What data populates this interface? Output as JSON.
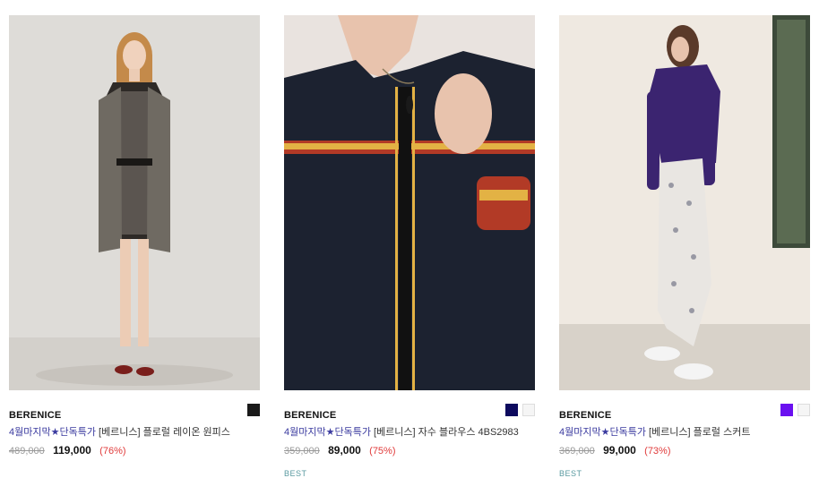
{
  "products": [
    {
      "brand": "BERENICE",
      "promo": "4월마지막★단독특가",
      "title": " [베르니스] 플로럴 레이온 원피스",
      "original_price": "489,000",
      "sale_price": "119,000",
      "discount": "(76%)",
      "swatches": [
        "#1a1a1a"
      ],
      "image": "model-floral-dress-fringe-vest"
    },
    {
      "brand": "BERENICE",
      "promo": "4월마지막★단독특가",
      "title": " [베르니스] 자수 블라우스 4BS2983",
      "original_price": "359,000",
      "sale_price": "89,000",
      "discount": "(75%)",
      "swatches": [
        "#0d0a5e",
        "#f5f5f5"
      ],
      "badge": "BEST",
      "image": "model-navy-embroidered-blouse"
    },
    {
      "brand": "BERENICE",
      "promo": "4월마지막★단독특가",
      "title": " [베르니스] 플로럴 스커트",
      "original_price": "369,000",
      "sale_price": "99,000",
      "discount": "(73%)",
      "swatches": [
        "#6a10f0",
        "#f5f5f5"
      ],
      "badge": "BEST",
      "image": "model-purple-top-floral-skirt"
    }
  ],
  "colors": {
    "promo_text": "#3a3a9f",
    "discount_text": "#e03a3a",
    "strike_price": "#999999",
    "badge": "#5a9aa0"
  }
}
